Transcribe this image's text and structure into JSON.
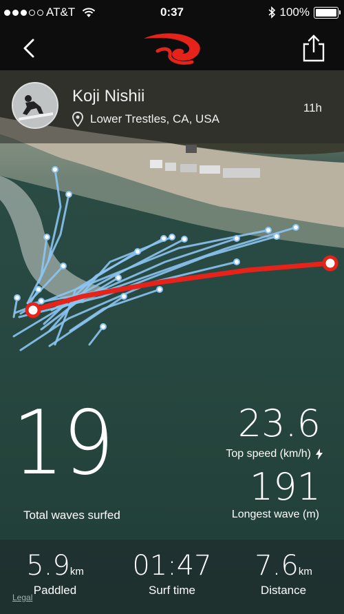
{
  "status_bar": {
    "carrier": "AT&T",
    "time": "0:37",
    "battery": "100%",
    "battery_level": 1.0
  },
  "profile": {
    "name": "Koji Nishii",
    "location": "Lower Trestles, CA, USA",
    "time_ago": "11h"
  },
  "colors": {
    "longest_wave": "#e5231b",
    "wave_tracks": "#8cc4f2",
    "brand": "#e5231b"
  },
  "stats": {
    "total_waves": "19",
    "total_waves_label": "Total waves surfed",
    "top_speed": "23.6",
    "top_speed_label": "Top speed (km/h)",
    "longest_wave": "191",
    "longest_wave_label": "Longest wave (m)"
  },
  "bottom": {
    "paddled": "5.9",
    "paddled_unit": "km",
    "paddled_label": "Paddled",
    "surf_time": "01:47",
    "surf_time_label": "Surf time",
    "distance": "7.6",
    "distance_unit": "km",
    "distance_label": "Distance",
    "legal": "Legal"
  }
}
